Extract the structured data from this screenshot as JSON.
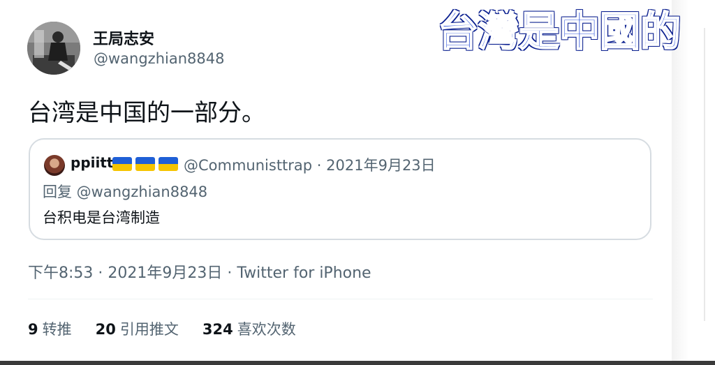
{
  "caption": "台灣是中國的",
  "tweet": {
    "display_name": "王局志安",
    "handle": "@wangzhian8848",
    "text": "台湾是中国的一部分。",
    "meta": "下午8:53 · 2021年9月23日 · Twitter for iPhone"
  },
  "quoted_tweet": {
    "name": "ppiitt",
    "flag_icons": [
      "ukraine-flag-icon",
      "ukraine-flag-icon",
      "ukraine-flag-icon"
    ],
    "handle_date": "@Communisttrap · 2021年9月23日",
    "reply_to": "回复 @wangzhian8848",
    "text": "台积电是台湾制造"
  },
  "stats": {
    "retweets_count": "9",
    "retweets_label": "转推",
    "quotes_count": "20",
    "quotes_label": "引用推文",
    "likes_count": "324",
    "likes_label": "喜欢次数"
  },
  "colors": {
    "caption_fill": "#1a44d8",
    "caption_outline": "#0a1f8f",
    "secondary_text": "#536471",
    "flag_blue": "#1f5fd6",
    "flag_yellow": "#f5c400"
  }
}
